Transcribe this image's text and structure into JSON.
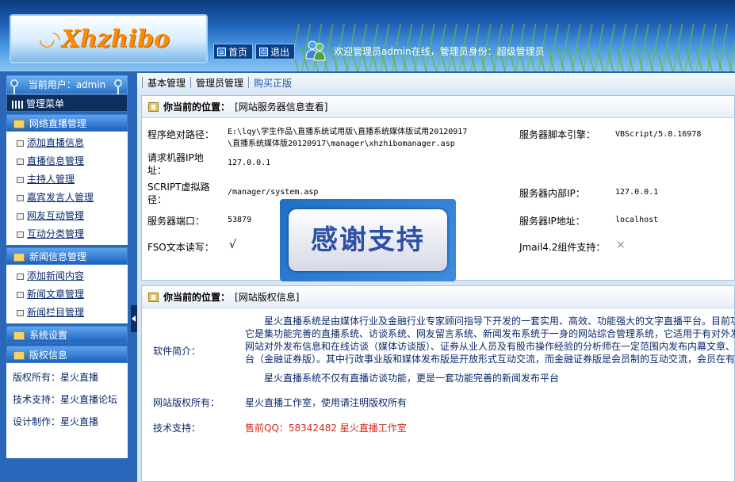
{
  "header": {
    "logo_smile": "◡◝",
    "logo_text": "Xhzhibo",
    "home_label": "首页",
    "logout_label": "退出",
    "welcome_text": "欢迎管理员admin在线，管理员身份：超级管理员"
  },
  "sidebar": {
    "current_user": "当前用户：admin",
    "menu_title": "管理菜单",
    "sections": [
      {
        "title": "网络直播管理",
        "items": [
          "添加直播信息",
          "直播信息管理",
          "主持人管理",
          "嘉宾发言人管理",
          "网友互动管理",
          "互动分类管理"
        ]
      },
      {
        "title": "新闻信息管理",
        "items": [
          "添加新闻内容",
          "新闻文章管理",
          "新闻栏目管理"
        ]
      },
      {
        "title": "系统设置"
      },
      {
        "title": "版权信息"
      }
    ],
    "copyright": [
      "版权所有：星火直播",
      "技术支持：星火直播论坛",
      "设计制作：星火直播"
    ]
  },
  "topnav": {
    "basic": "基本管理",
    "admin": "管理员管理",
    "buy": "购买正版"
  },
  "server_panel": {
    "title_prefix": "你当前的位置：",
    "title": "[网站服务器信息查看]",
    "path_label": "程序绝对路径：",
    "path_value_1": "E:\\lqy\\学生作品\\直播系统试用版\\直播系统媒体版试用20120917",
    "path_value_2": "\\直播系统媒体版20120917\\manager\\xhzhibomanager.asp",
    "script_engine_label": "服务器脚本引擎：",
    "script_engine_value": "VBScript/5.8.16978",
    "client_ip_label": "请求机器IP地址：",
    "client_ip_value": "127.0.0.1",
    "script_path_label": "SCRIPT虚拟路径：",
    "script_path_value": "/manager/system.asp",
    "internal_ip_label": "服务器内部IP：",
    "internal_ip_value": "127.0.0.1",
    "port_label": "服务器端口：",
    "port_value": "53879",
    "server_ip_label": "服务器IP地址：",
    "server_ip_value": "localhost",
    "fso_label": "FSO文本读写：",
    "fso_value": "√",
    "jmail_label": "Jmail4.2组件支持：",
    "jmail_value": "×"
  },
  "thanks_badge": "感谢支持",
  "copyright_panel": {
    "title_prefix": "你当前的位置：",
    "title": "[网站版权信息]",
    "intro_label": "软件简介：",
    "intro_lines": [
      "星火直播系统是由媒体行业及金融行业专家顾问指导下开发的一套实用、高效、功能强大的文字直播平台。目前功",
      "它是集功能完善的直播系统、访谈系统、网友留言系统、新闻发布系统于一身的网站综合管理系统，它适用于有对外发",
      "网站对外发布信息和在线访谈（媒体访谈版）、证券从业人员及有股市操作经验的分析师在一定范围内发布内幕文章、",
      "台（金融证券版）。其中行政事业版和媒体发布版是开放形式互动交流，而金融证券版是会员制的互动交流，会员在有"
    ],
    "intro_tail": "星火直播系统不仅有直播访谈功能，更是一套功能完善的新闻发布平台",
    "owner_label": "网站版权所有：",
    "owner_value": "星火直播工作室，使用请注明版权所有",
    "support_label": "技术支持：",
    "support_value": "售前QQ：58342482 星火直播工作室"
  }
}
